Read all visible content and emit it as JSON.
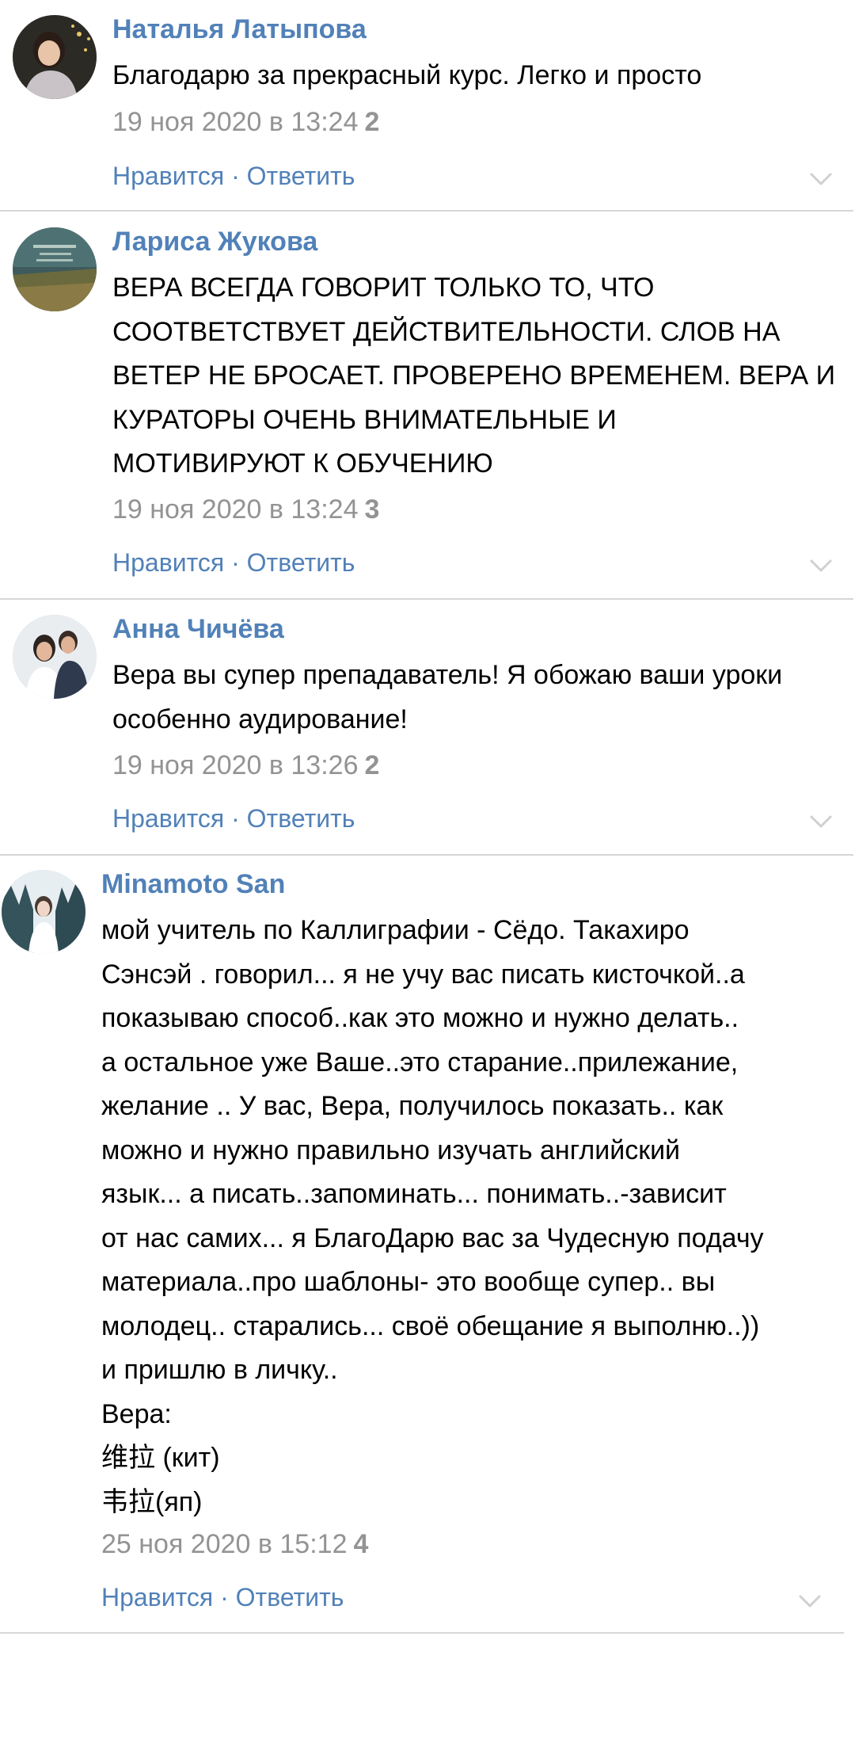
{
  "colors": {
    "link": "#5181b8",
    "meta": "#939393",
    "divider": "#d6d6d6"
  },
  "actions": {
    "like": "Нравится",
    "separator": " · ",
    "reply": "Ответить"
  },
  "comments": [
    {
      "author": "Наталья Латыпова",
      "avatar_icon": "user-avatar",
      "text_lines": [
        "Благодарю за прекрасный курс. Легко и просто"
      ],
      "date": "19 ноя 2020 в 13:24",
      "likes": "2"
    },
    {
      "author": "Лариса Жукова",
      "avatar_icon": "user-avatar",
      "text_lines": [
        "ВЕРА ВСЕГДА ГОВОРИТ ТОЛЬКО ТО, ЧТО",
        "СООТВЕТСТВУЕТ ДЕЙСТВИТЕЛЬНОСТИ. СЛОВ НА",
        "ВЕТЕР НЕ БРОСАЕТ. ПРОВЕРЕНО ВРЕМЕНЕМ. ВЕРА И",
        "КУРАТОРЫ ОЧЕНЬ ВНИМАТЕЛЬНЫЕ И",
        "МОТИВИРУЮТ К ОБУЧЕНИЮ"
      ],
      "date": "19 ноя 2020 в 13:24",
      "likes": "3"
    },
    {
      "author": "Анна Чичёва",
      "avatar_icon": "user-avatar",
      "text_lines": [
        "Вера вы супер препадаватель! Я обожаю ваши уроки",
        "особенно аудирование!"
      ],
      "date": "19 ноя 2020 в 13:26",
      "likes": "2"
    },
    {
      "author": "Minamoto San",
      "avatar_icon": "user-avatar",
      "text_lines": [
        "мой учитель по Каллиграфии - Сёдо. Такахиро",
        "Сэнсэй . говорил... я не учу вас писать кисточкой..а",
        "показываю способ..как это можно и нужно делать..",
        "а остальное уже Ваше..это старание..прилежание,",
        "желание .. У вас, Вера, получилось показать.. как",
        "можно и нужно правильно изучать английский",
        "язык... а писать..запоминать... понимать..-зависит",
        "от нас самих... я БлагоДарю вас за Чудесную подачу",
        "материала..про шаблоны- это вообще супер.. вы",
        "молодец.. старались... своё обещание я выполню..))",
        "и пришлю в личку..",
        "Вера:",
        "维拉 (кит)",
        "韦拉(яп)"
      ],
      "date": "25 ноя 2020 в 15:12",
      "likes": "4"
    }
  ]
}
